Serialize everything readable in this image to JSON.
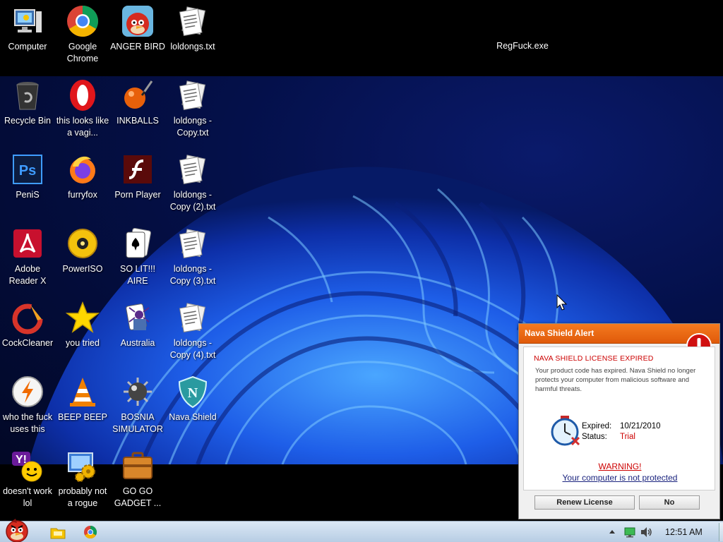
{
  "desktop": {
    "icons": [
      {
        "label": "Computer",
        "icon": "computer-icon"
      },
      {
        "label": "Google Chrome",
        "icon": "chrome-icon"
      },
      {
        "label": "ANGER BIRD",
        "icon": "angry-bird-icon"
      },
      {
        "label": "loldongs.txt",
        "icon": "text-file-icon"
      },
      {
        "label": "Recycle Bin",
        "icon": "recycle-bin-icon"
      },
      {
        "label": "this looks like a vagi...",
        "icon": "opera-icon"
      },
      {
        "label": "INKBALLS",
        "icon": "inkball-icon"
      },
      {
        "label": "loldongs - Copy.txt",
        "icon": "text-file-icon"
      },
      {
        "label": "PeniS",
        "icon": "photoshop-icon"
      },
      {
        "label": "furryfox",
        "icon": "firefox-icon"
      },
      {
        "label": "Porn Player",
        "icon": "flash-icon"
      },
      {
        "label": "loldongs - Copy (2).txt",
        "icon": "text-file-icon"
      },
      {
        "label": "Adobe Reader X",
        "icon": "adobe-reader-icon"
      },
      {
        "label": "PowerISO",
        "icon": "poweriso-icon"
      },
      {
        "label": "SO LIT!!! AIRE",
        "icon": "solitaire-icon"
      },
      {
        "label": "loldongs - Copy (3).txt",
        "icon": "text-file-icon"
      },
      {
        "label": "CockCleaner",
        "icon": "ccleaner-icon"
      },
      {
        "label": "you tried",
        "icon": "star-icon"
      },
      {
        "label": "Australia",
        "icon": "spider-solitaire-icon"
      },
      {
        "label": "loldongs - Copy (4).txt",
        "icon": "text-file-icon"
      },
      {
        "label": "who the fuck uses this",
        "icon": "winamp-icon"
      },
      {
        "label": "BEEP BEEP",
        "icon": "vlc-icon"
      },
      {
        "label": "BOSNIA SIMULATOR",
        "icon": "minesweeper-icon"
      },
      {
        "label": "Nava Shield",
        "icon": "nava-shield-icon"
      },
      {
        "label": "doesn't work lol",
        "icon": "yahoo-messenger-icon"
      },
      {
        "label": "probably not a rogue",
        "icon": "control-panel-icon"
      },
      {
        "label": "GO GO GADGET ...",
        "icon": "gadget-briefcase-icon"
      }
    ],
    "regfuck_label": "RegFuck.exe"
  },
  "taskbar": {
    "clock": "12:51 AM",
    "items": [
      "start-orb-icon",
      "explorer-icon",
      "chrome-icon"
    ],
    "tray": [
      "up-arrow-icon",
      "network-icon",
      "volume-icon"
    ]
  },
  "alert": {
    "title": "Nava Shield Alert",
    "heading": "NAVA SHIELD LICENSE EXPIRED",
    "message": "Your product code has expired. Nava Shield no longer protects your computer from malicious software and harmful threats.",
    "expired_label": "Expired:",
    "expired_value": "10/21/2010",
    "status_label": "Status:",
    "status_value": "Trial",
    "warning": "WARNING!",
    "unprotected": "Your computer is not protected",
    "renew_button": "Renew License",
    "no_button": "No",
    "colors": {
      "title_bar": "#f07020",
      "alert_red": "#cc0000"
    }
  }
}
